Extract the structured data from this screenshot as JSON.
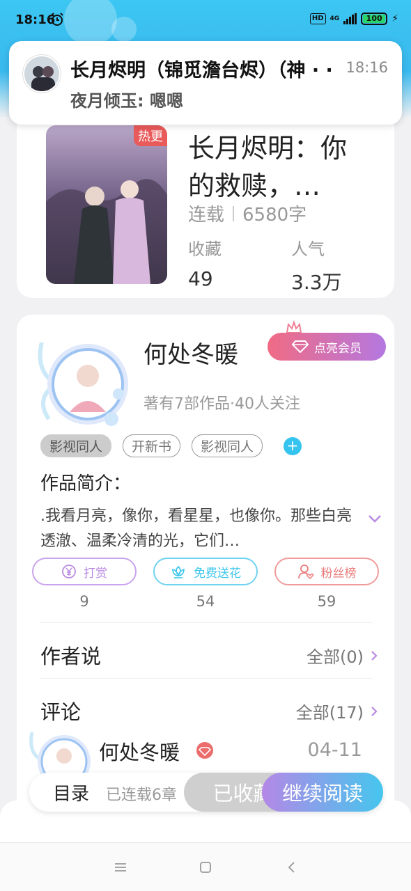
{
  "status_bar": {
    "time": "18:16",
    "network": "4G",
    "hd": "HD",
    "battery": "100"
  },
  "notification": {
    "title": "长月烬明（锦觅澹台烬）（神 · ·",
    "time": "18:16",
    "message": "夜月倾玉: 嗯嗯"
  },
  "book": {
    "hot_badge": "热更",
    "title": "长月烬明：你的救赎，…",
    "status": "连载",
    "word_count": "6580字",
    "stats": [
      {
        "label": "收藏",
        "value": "49"
      },
      {
        "label": "人气",
        "value": "3.3万"
      }
    ]
  },
  "author": {
    "name": "何处冬暖",
    "vip_button": "点亮会员",
    "info": "著有7部作品·40人关注",
    "tags": [
      "影视同人",
      "开新书",
      "影视同人"
    ],
    "add_tag": "+"
  },
  "intro": {
    "label": "作品简介：",
    "text": ".我看月亮，像你，看星星，也像你。那些白亮透澈、温柔冷清的光，它们…"
  },
  "actions": [
    {
      "label": "打赏",
      "count": "9",
      "color": "#b98ae0"
    },
    {
      "label": "免费送花",
      "count": "54",
      "color": "#3cc6ec"
    },
    {
      "label": "粉丝榜",
      "count": "59",
      "color": "#ea7a7a"
    }
  ],
  "author_says": {
    "title": "作者说",
    "link": "全部(0)"
  },
  "comments": {
    "title": "评论",
    "link": "全部(17)",
    "first": {
      "name": "何处冬暖",
      "date": "04-11"
    }
  },
  "bottom_bar": {
    "toc": "目录",
    "serial": "已连载6章",
    "favorited": "已收藏",
    "continue": "继续阅读"
  }
}
